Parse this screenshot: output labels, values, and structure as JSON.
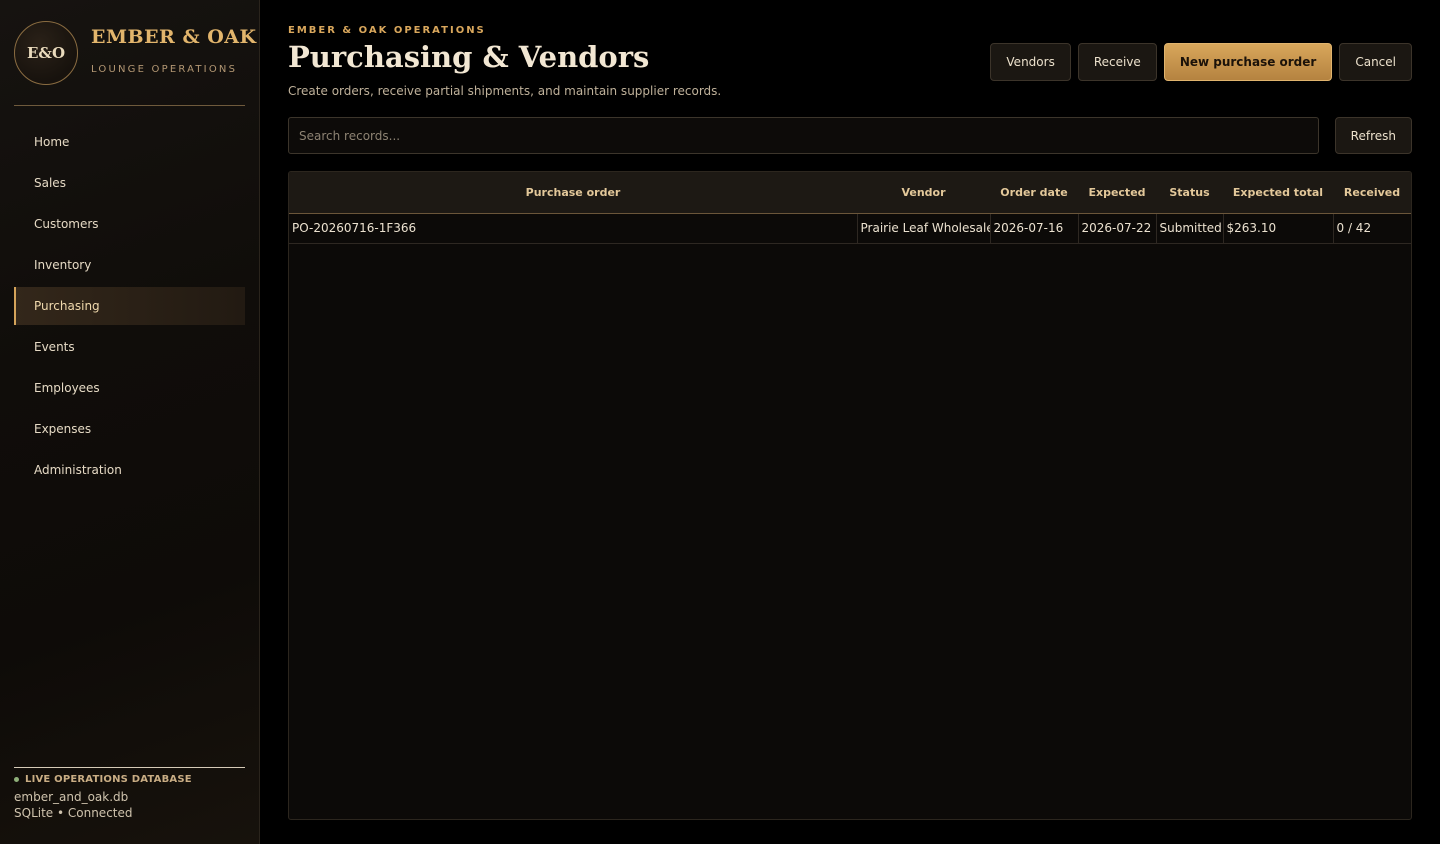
{
  "brand": {
    "mark": "E&O",
    "name": "EMBER & OAK",
    "subtitle": "LOUNGE OPERATIONS"
  },
  "sidebar": {
    "items": [
      {
        "label": "Home",
        "active": false
      },
      {
        "label": "Sales",
        "active": false
      },
      {
        "label": "Customers",
        "active": false
      },
      {
        "label": "Inventory",
        "active": false
      },
      {
        "label": "Purchasing",
        "active": true
      },
      {
        "label": "Events",
        "active": false
      },
      {
        "label": "Employees",
        "active": false
      },
      {
        "label": "Expenses",
        "active": false
      },
      {
        "label": "Administration",
        "active": false
      }
    ],
    "db": {
      "label": "LIVE OPERATIONS DATABASE",
      "file": "ember_and_oak.db",
      "connection": "SQLite • Connected"
    }
  },
  "header": {
    "eyebrow": "EMBER & OAK OPERATIONS",
    "title": "Purchasing & Vendors",
    "description": "Create orders, receive partial shipments, and maintain supplier records."
  },
  "toolbar": {
    "vendors_label": "Vendors",
    "receive_label": "Receive",
    "new_po_label": "New purchase order",
    "cancel_label": "Cancel"
  },
  "search": {
    "placeholder": "Search records...",
    "value": "",
    "refresh_label": "Refresh"
  },
  "table": {
    "columns": [
      "Purchase order",
      "Vendor",
      "Order date",
      "Expected",
      "Status",
      "Expected total",
      "Received"
    ],
    "rows": [
      [
        "PO-20260716-1F366",
        "Prairie Leaf Wholesale",
        "2026-07-16",
        "2026-07-22",
        "Submitted",
        "$263.10",
        "0 / 42"
      ]
    ]
  },
  "colors": {
    "accent": "#d9a75c",
    "background": "#000000",
    "sidebar": "#110e0b",
    "status_ok": "#8fb07a"
  }
}
